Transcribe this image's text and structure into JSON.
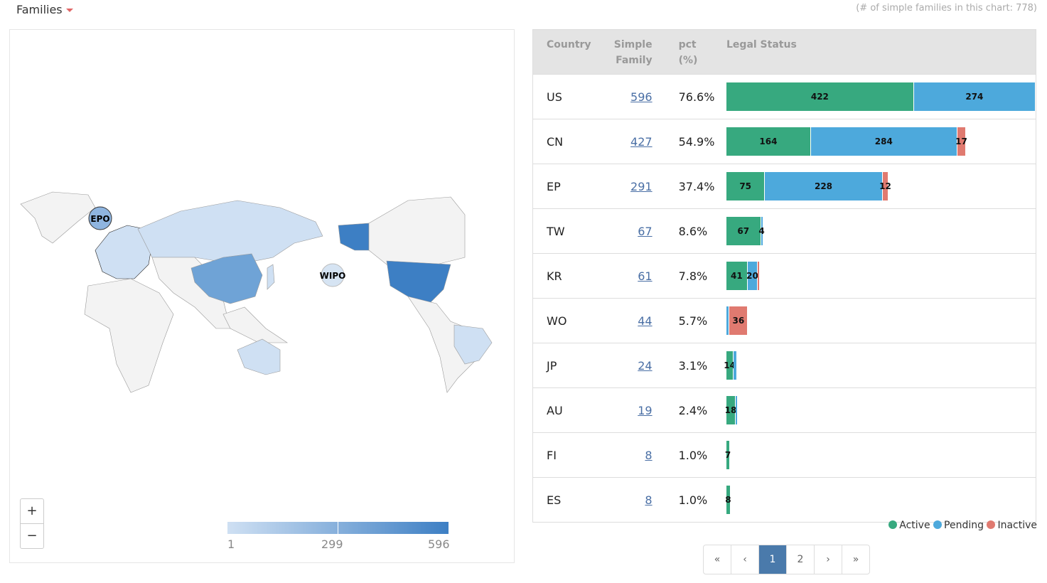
{
  "header": {
    "title": "Families",
    "count_text": "(# of simple families in this chart: 778)"
  },
  "map": {
    "badges": {
      "epo": "EPO",
      "wipo": "WIPO"
    },
    "zoom_in": "+",
    "zoom_out": "−",
    "scale": {
      "min": "1",
      "mid": "299",
      "max": "596",
      "color_low": "#cfe0f3",
      "color_high": "#3d7fc4"
    }
  },
  "table": {
    "headers": {
      "country": "Country",
      "family": "Simple Family",
      "pct": "pct (%)",
      "status": "Legal Status"
    },
    "rows": [
      {
        "country": "US",
        "family": "596",
        "pct": "76.6%",
        "active": 422,
        "pending": 274,
        "inactive": 0,
        "labels": [
          "422",
          "274",
          ""
        ]
      },
      {
        "country": "CN",
        "family": "427",
        "pct": "54.9%",
        "active": 164,
        "pending": 284,
        "inactive": 17,
        "labels": [
          "164",
          "284",
          "17"
        ]
      },
      {
        "country": "EP",
        "family": "291",
        "pct": "37.4%",
        "active": 75,
        "pending": 228,
        "inactive": 12,
        "labels": [
          "75",
          "228",
          "12"
        ]
      },
      {
        "country": "TW",
        "family": "67",
        "pct": "8.6%",
        "active": 67,
        "pending": 4,
        "inactive": 0,
        "labels": [
          "67",
          "4",
          ""
        ]
      },
      {
        "country": "KR",
        "family": "61",
        "pct": "7.8%",
        "active": 41,
        "pending": 20,
        "inactive": 2,
        "labels": [
          "41",
          "20",
          ""
        ]
      },
      {
        "country": "WO",
        "family": "44",
        "pct": "5.7%",
        "active": 0,
        "pending": 6,
        "inactive": 36,
        "labels": [
          "",
          "",
          "36"
        ]
      },
      {
        "country": "JP",
        "family": "24",
        "pct": "3.1%",
        "active": 14,
        "pending": 7,
        "inactive": 0,
        "labels": [
          "14",
          "",
          ""
        ]
      },
      {
        "country": "AU",
        "family": "19",
        "pct": "2.4%",
        "active": 18,
        "pending": 2,
        "inactive": 0,
        "labels": [
          "18",
          "",
          ""
        ]
      },
      {
        "country": "FI",
        "family": "8",
        "pct": "1.0%",
        "active": 7,
        "pending": 0,
        "inactive": 0,
        "labels": [
          "7",
          "",
          ""
        ]
      },
      {
        "country": "ES",
        "family": "8",
        "pct": "1.0%",
        "active": 8,
        "pending": 0,
        "inactive": 0,
        "labels": [
          "8",
          "",
          ""
        ]
      }
    ]
  },
  "legend": {
    "active": "Active",
    "pending": "Pending",
    "inactive": "Inactive"
  },
  "colors": {
    "active": "#37a97f",
    "pending": "#4da9dc",
    "inactive": "#e07a70"
  },
  "pager": {
    "first": "«",
    "prev": "‹",
    "pages": [
      "1",
      "2"
    ],
    "current": "1",
    "next": "›",
    "last": "»"
  }
}
